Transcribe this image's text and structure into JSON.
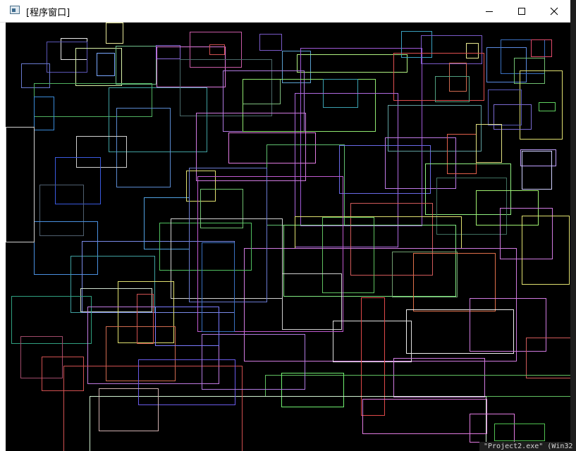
{
  "window": {
    "title": "[程序窗口]",
    "icon": "app-window-icon",
    "controls": [
      "minimize-icon",
      "maximize-icon",
      "close-icon"
    ]
  },
  "canvas": {
    "background": "#000000"
  },
  "console": {
    "line": "\"Project2.exe\" (Win32"
  }
}
